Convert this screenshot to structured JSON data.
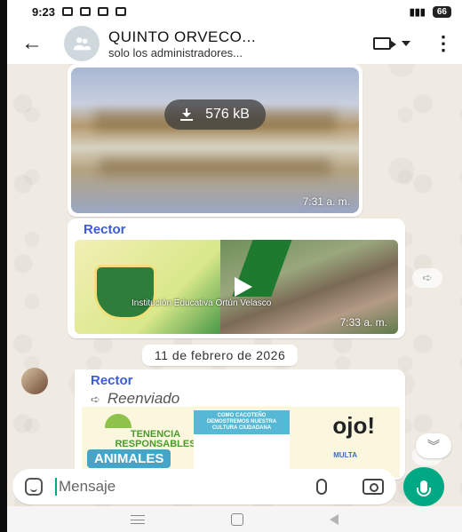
{
  "status_bar": {
    "time": "9:23",
    "battery": "66"
  },
  "header": {
    "back_icon": "arrow-left-icon",
    "title": "QUINTO ORVECO...",
    "subtitle": "solo los administradores..."
  },
  "messages": [
    {
      "type": "image",
      "download_size": "576 kB",
      "time": "7:31 a. m."
    },
    {
      "type": "video",
      "sender": "Rector",
      "video_caption": "Institución Educativa Ortún Velasco",
      "time": "7:33 a. m."
    },
    {
      "type": "image",
      "sender": "Rector",
      "forwarded_label": "Reenviado",
      "poster": {
        "left_title": "TENENCIA RESPONSABLES",
        "left_badge": "ANIMALES",
        "mid_heading": "COMO CACOTEÑO DEMOSTREMOS NUESTRA CULTURA CIUDADANA",
        "right_heading": "ojo!",
        "right_sub": "MULTA"
      }
    }
  ],
  "date_separator": "11 de febrero de 2026",
  "composer": {
    "placeholder": "Mensaje"
  },
  "colors": {
    "accent": "#00a884",
    "sender": "#3b5bdb",
    "background": "#efeae2"
  }
}
